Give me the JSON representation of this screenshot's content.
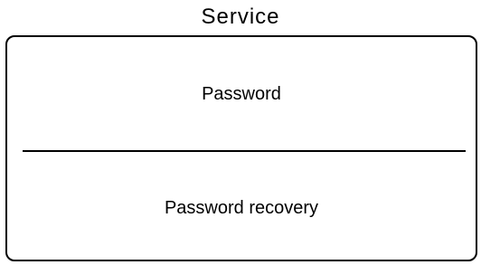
{
  "screen": {
    "title": "Service"
  },
  "menu": {
    "items": [
      {
        "label": "Password"
      },
      {
        "label": "Password recovery"
      }
    ]
  }
}
